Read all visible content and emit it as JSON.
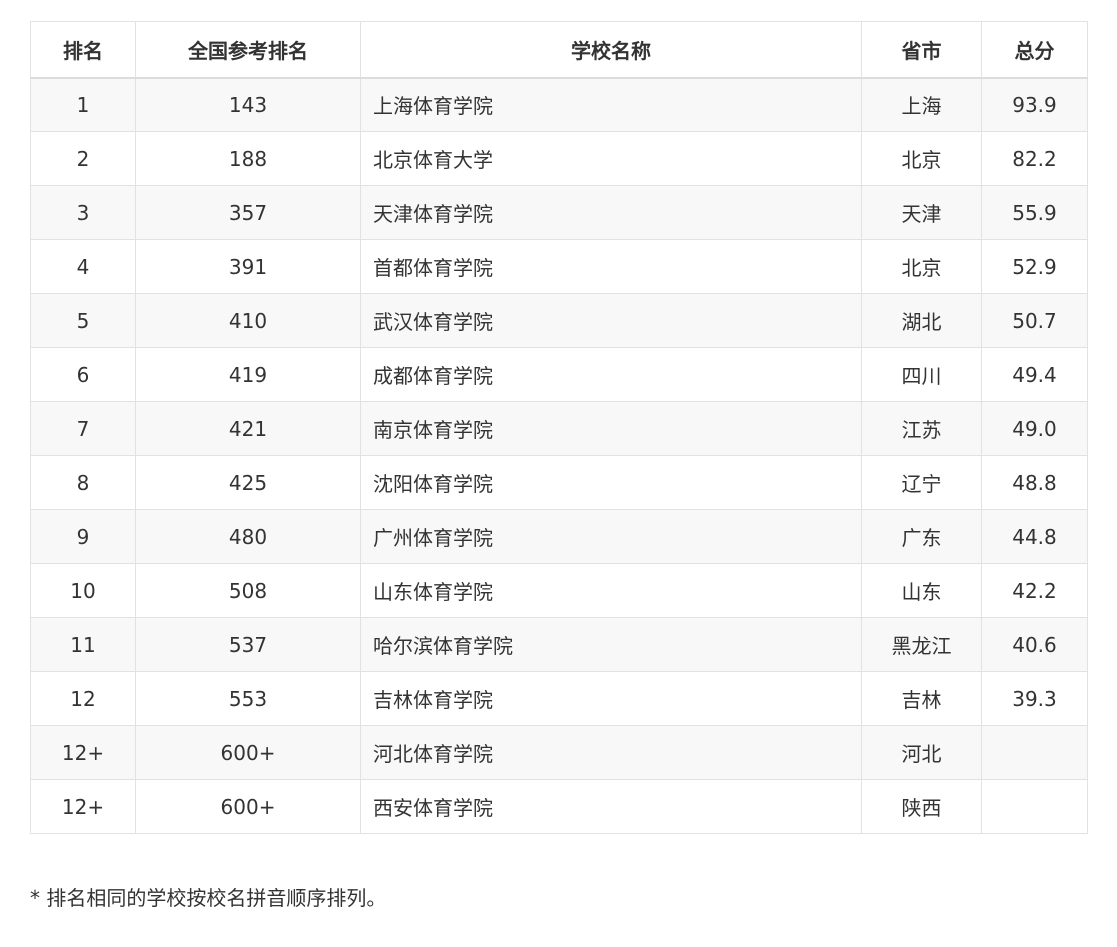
{
  "table": {
    "headers": {
      "rank": "排名",
      "national_rank": "全国参考排名",
      "school": "学校名称",
      "province": "省市",
      "score": "总分"
    },
    "rows": [
      {
        "rank": "1",
        "national_rank": "143",
        "school": "上海体育学院",
        "province": "上海",
        "score": "93.9"
      },
      {
        "rank": "2",
        "national_rank": "188",
        "school": "北京体育大学",
        "province": "北京",
        "score": "82.2"
      },
      {
        "rank": "3",
        "national_rank": "357",
        "school": "天津体育学院",
        "province": "天津",
        "score": "55.9"
      },
      {
        "rank": "4",
        "national_rank": "391",
        "school": "首都体育学院",
        "province": "北京",
        "score": "52.9"
      },
      {
        "rank": "5",
        "national_rank": "410",
        "school": "武汉体育学院",
        "province": "湖北",
        "score": "50.7"
      },
      {
        "rank": "6",
        "national_rank": "419",
        "school": "成都体育学院",
        "province": "四川",
        "score": "49.4"
      },
      {
        "rank": "7",
        "national_rank": "421",
        "school": "南京体育学院",
        "province": "江苏",
        "score": "49.0"
      },
      {
        "rank": "8",
        "national_rank": "425",
        "school": "沈阳体育学院",
        "province": "辽宁",
        "score": "48.8"
      },
      {
        "rank": "9",
        "national_rank": "480",
        "school": "广州体育学院",
        "province": "广东",
        "score": "44.8"
      },
      {
        "rank": "10",
        "national_rank": "508",
        "school": "山东体育学院",
        "province": "山东",
        "score": "42.2"
      },
      {
        "rank": "11",
        "national_rank": "537",
        "school": "哈尔滨体育学院",
        "province": "黑龙江",
        "score": "40.6"
      },
      {
        "rank": "12",
        "national_rank": "553",
        "school": "吉林体育学院",
        "province": "吉林",
        "score": "39.3"
      },
      {
        "rank": "12+",
        "national_rank": "600+",
        "school": "河北体育学院",
        "province": "河北",
        "score": ""
      },
      {
        "rank": "12+",
        "national_rank": "600+",
        "school": "西安体育学院",
        "province": "陕西",
        "score": ""
      }
    ]
  },
  "footnote": "* 排名相同的学校按校名拼音顺序排列。"
}
